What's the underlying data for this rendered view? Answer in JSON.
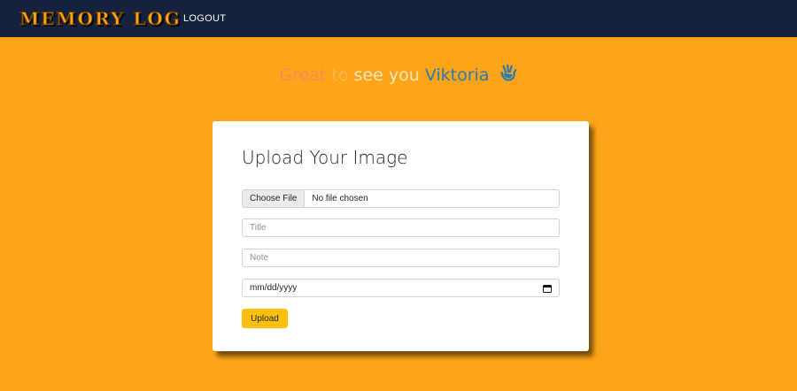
{
  "navbar": {
    "brand": "MEMORY LOG",
    "logout_label": "LOGOUT"
  },
  "greeting": {
    "part1": "Great",
    "part2": "to",
    "part3": "see you",
    "name": "Viktoria",
    "icon": "waving-hand-icon"
  },
  "upload_form": {
    "heading": "Upload Your Image",
    "file_button_label": "Choose File",
    "file_status": "No file chosen",
    "title_placeholder": "Title",
    "note_placeholder": "Note",
    "date_placeholder": "mm/dd/yyyy",
    "date_icon": "calendar-icon",
    "submit_label": "Upload"
  },
  "colors": {
    "page_background": "#fea418",
    "navbar_background": "#15213d",
    "brand": "#fea418",
    "button": "#fcbf0a",
    "name": "#2d7ab0"
  }
}
